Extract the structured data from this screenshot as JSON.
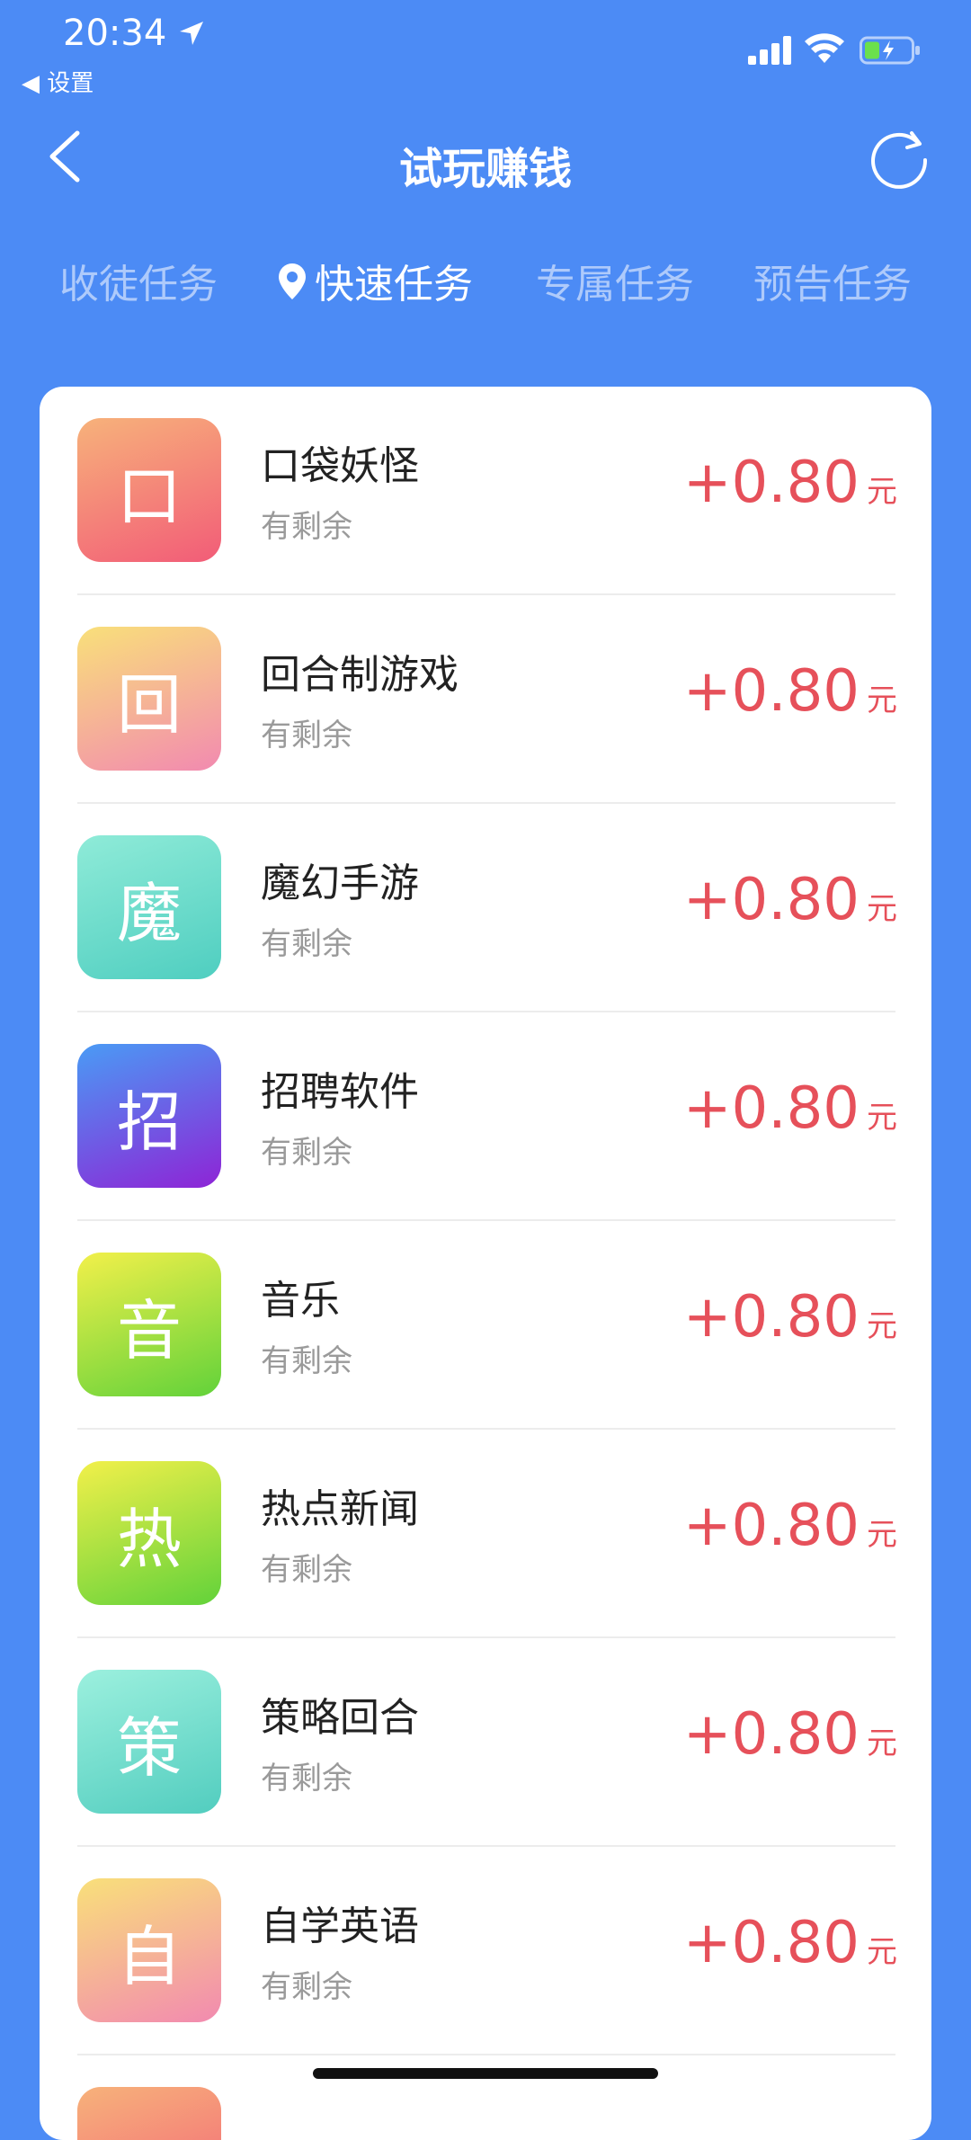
{
  "status_bar": {
    "time": "20:34",
    "back_label": "◀ 设置"
  },
  "nav": {
    "title": "试玩赚钱"
  },
  "tabs": [
    {
      "label": "收徒任务",
      "active": false
    },
    {
      "label": "快速任务",
      "active": true
    },
    {
      "label": "专属任务",
      "active": false
    },
    {
      "label": "预告任务",
      "active": false
    }
  ],
  "tasks": [
    {
      "icon_char": "口",
      "name": "口袋妖怪",
      "status": "有剩余",
      "reward": "+0.80",
      "unit": "元",
      "gradient": [
        "#F7B27A",
        "#F25C78"
      ]
    },
    {
      "icon_char": "回",
      "name": "回合制游戏",
      "status": "有剩余",
      "reward": "+0.80",
      "unit": "元",
      "gradient": [
        "#F9E07A",
        "#F28AB0"
      ]
    },
    {
      "icon_char": "魔",
      "name": "魔幻手游",
      "status": "有剩余",
      "reward": "+0.80",
      "unit": "元",
      "gradient": [
        "#8FEBD8",
        "#4FCEC0"
      ]
    },
    {
      "icon_char": "招",
      "name": "招聘软件",
      "status": "有剩余",
      "reward": "+0.80",
      "unit": "元",
      "gradient": [
        "#4A9BF5",
        "#8E24D6"
      ]
    },
    {
      "icon_char": "音",
      "name": "音乐",
      "status": "有剩余",
      "reward": "+0.80",
      "unit": "元",
      "gradient": [
        "#F2F04A",
        "#62D23A"
      ]
    },
    {
      "icon_char": "热",
      "name": "热点新闻",
      "status": "有剩余",
      "reward": "+0.80",
      "unit": "元",
      "gradient": [
        "#F2F04A",
        "#62D23A"
      ]
    },
    {
      "icon_char": "策",
      "name": "策略回合",
      "status": "有剩余",
      "reward": "+0.80",
      "unit": "元",
      "gradient": [
        "#9CF0DE",
        "#52CDBF"
      ]
    },
    {
      "icon_char": "自",
      "name": "自学英语",
      "status": "有剩余",
      "reward": "+0.80",
      "unit": "元",
      "gradient": [
        "#F9E07A",
        "#F28AB0"
      ]
    }
  ],
  "colors": {
    "background": "#4C8BF5",
    "reward": "#E6505A"
  }
}
